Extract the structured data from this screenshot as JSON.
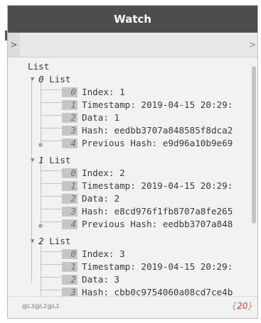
{
  "node": {
    "title": "Watch"
  },
  "ports": {
    "input_label": ">",
    "output_label": ">"
  },
  "tree": {
    "root_label": "List",
    "lists": [
      {
        "index": "0",
        "label": "List",
        "items": [
          {
            "index": "0",
            "text": "Index: 1"
          },
          {
            "index": "1",
            "text": "Timestamp: 2019-04-15 20:29:"
          },
          {
            "index": "2",
            "text": "Data: 1"
          },
          {
            "index": "3",
            "text": "Hash: eedbb3707a848585f8dca2"
          },
          {
            "index": "4",
            "text": "Previous Hash: e9d96a10b9e69"
          }
        ]
      },
      {
        "index": "1",
        "label": "List",
        "items": [
          {
            "index": "0",
            "text": "Index: 2"
          },
          {
            "index": "1",
            "text": "Timestamp: 2019-04-15 20:29:"
          },
          {
            "index": "2",
            "text": "Data: 2"
          },
          {
            "index": "3",
            "text": "Hash: e8cd976f1fb8707a8fe265"
          },
          {
            "index": "4",
            "text": "Previous Hash: eedbb3707a848"
          }
        ]
      },
      {
        "index": "2",
        "label": "List",
        "items": [
          {
            "index": "0",
            "text": "Index: 3"
          },
          {
            "index": "1",
            "text": "Timestamp: 2019-04-15 20:29:"
          },
          {
            "index": "2",
            "text": "Data: 3"
          },
          {
            "index": "3",
            "text": "Hash: cbb0c9754060a08cd7ce4b"
          }
        ]
      }
    ]
  },
  "footer": {
    "levels": [
      "@L3",
      "@L2",
      "@L1"
    ],
    "count_open": "{",
    "count": "20",
    "count_close": "}"
  },
  "colors": {
    "header_bg": "#4d4d4d",
    "toggle_blue": "#4a90d9",
    "count_red": "#d2443a"
  },
  "icons": {
    "expand_toggle": "triangle-down-icon"
  }
}
